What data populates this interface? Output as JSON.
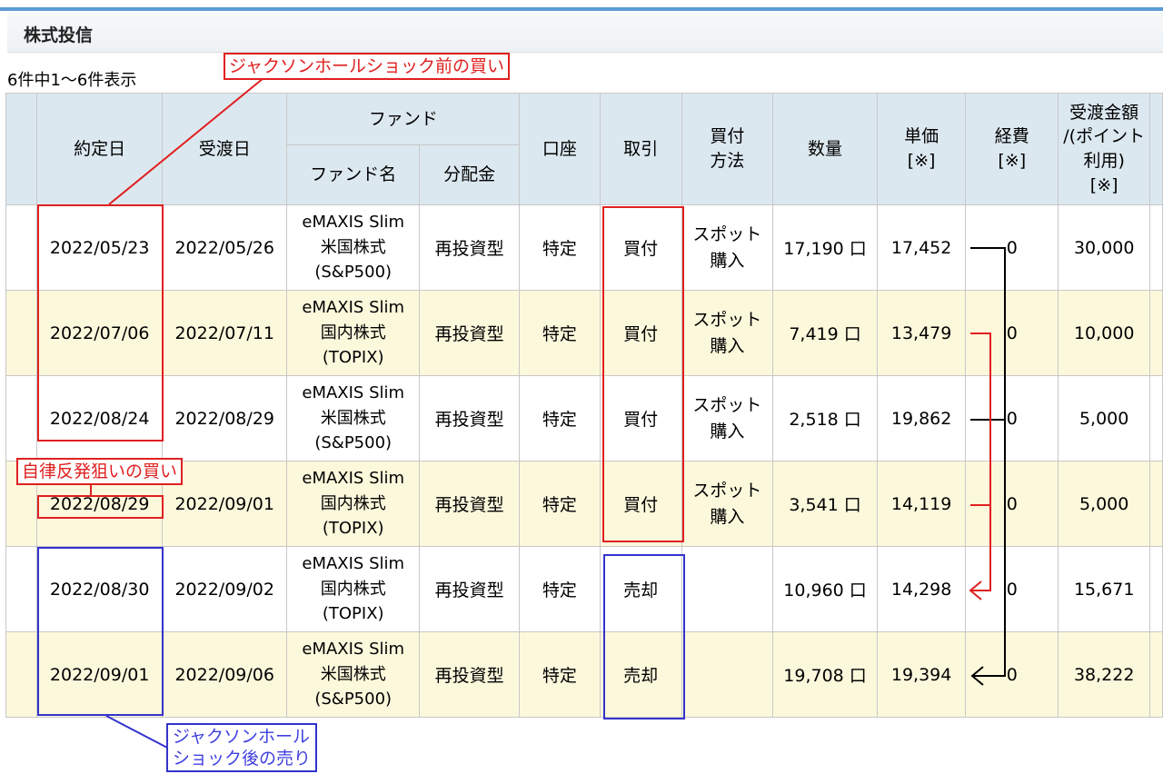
{
  "page": {
    "section_title": "株式投信",
    "result_count": "6件中1～6件表示"
  },
  "table": {
    "headers": {
      "trade_date": "約定日",
      "settle_date": "受渡日",
      "fund_group": "ファンド",
      "fund_name": "ファンド名",
      "distribution": "分配金",
      "account": "口座",
      "transaction": "取引",
      "method": [
        "買付",
        "方法"
      ],
      "quantity": "数量",
      "unit_price": [
        "単価",
        "[※]"
      ],
      "expense": [
        "経費",
        "[※]"
      ],
      "amount": [
        "受渡金額",
        "/(ポイント",
        "利用)",
        "[※]"
      ]
    },
    "rows": [
      {
        "trade_date": "2022/05/23",
        "settle_date": "2022/05/26",
        "fund": [
          "eMAXIS Slim",
          "米国株式",
          "(S&P500)"
        ],
        "distribution": "再投資型",
        "account": "特定",
        "transaction": "買付",
        "method": [
          "スポット",
          "購入"
        ],
        "quantity": "17,190 口",
        "unit_price": "17,452",
        "expense": "0",
        "amount": "30,000"
      },
      {
        "trade_date": "2022/07/06",
        "settle_date": "2022/07/11",
        "fund": [
          "eMAXIS Slim",
          "国内株式",
          "(TOPIX)"
        ],
        "distribution": "再投資型",
        "account": "特定",
        "transaction": "買付",
        "method": [
          "スポット",
          "購入"
        ],
        "quantity": "7,419 口",
        "unit_price": "13,479",
        "expense": "0",
        "amount": "10,000"
      },
      {
        "trade_date": "2022/08/24",
        "settle_date": "2022/08/29",
        "fund": [
          "eMAXIS Slim",
          "米国株式",
          "(S&P500)"
        ],
        "distribution": "再投資型",
        "account": "特定",
        "transaction": "買付",
        "method": [
          "スポット",
          "購入"
        ],
        "quantity": "2,518 口",
        "unit_price": "19,862",
        "expense": "0",
        "amount": "5,000"
      },
      {
        "trade_date": "2022/08/29",
        "settle_date": "2022/09/01",
        "fund": [
          "eMAXIS Slim",
          "国内株式",
          "(TOPIX)"
        ],
        "distribution": "再投資型",
        "account": "特定",
        "transaction": "買付",
        "method": [
          "スポット",
          "購入"
        ],
        "quantity": "3,541 口",
        "unit_price": "14,119",
        "expense": "0",
        "amount": "5,000"
      },
      {
        "trade_date": "2022/08/30",
        "settle_date": "2022/09/02",
        "fund": [
          "eMAXIS Slim",
          "国内株式",
          "(TOPIX)"
        ],
        "distribution": "再投資型",
        "account": "特定",
        "transaction": "売却",
        "method": [
          "",
          ""
        ],
        "quantity": "10,960 口",
        "unit_price": "14,298",
        "expense": "0",
        "amount": "15,671"
      },
      {
        "trade_date": "2022/09/01",
        "settle_date": "2022/09/06",
        "fund": [
          "eMAXIS Slim",
          "米国株式",
          "(S&P500)"
        ],
        "distribution": "再投資型",
        "account": "特定",
        "transaction": "売却",
        "method": [
          "",
          ""
        ],
        "quantity": "19,708 口",
        "unit_price": "19,394",
        "expense": "0",
        "amount": "38,222"
      }
    ]
  },
  "annotations": {
    "jackson_hole_buy": "ジャクソンホールショック前の買い",
    "rebound_buy": "自律反発狙いの買い",
    "jackson_hole_sell": [
      "ジャクソンホール",
      "ショック後の売り"
    ]
  },
  "colors": {
    "header_bg": "#dce8f0",
    "alt_row_bg": "#fcf8dc",
    "annotation_red": "#e02020",
    "annotation_blue": "#3333cc",
    "top_accent": "#5b9bd5"
  }
}
